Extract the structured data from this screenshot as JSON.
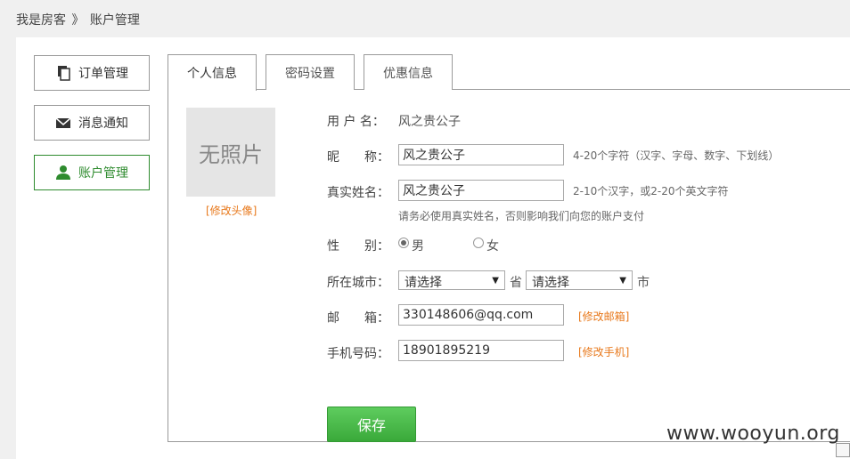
{
  "breadcrumb": {
    "home": "我是房客",
    "separator": "》",
    "current": "账户管理"
  },
  "sidebar": {
    "items": [
      {
        "label": "订单管理",
        "icon": "document-icon"
      },
      {
        "label": "消息通知",
        "icon": "envelope-icon"
      },
      {
        "label": "账户管理",
        "icon": "user-icon",
        "active": true
      }
    ]
  },
  "tabs": [
    {
      "label": "个人信息",
      "active": true
    },
    {
      "label": "密码设置"
    },
    {
      "label": "优惠信息"
    }
  ],
  "avatar": {
    "placeholder": "无照片",
    "edit_link": "[修改头像]"
  },
  "form": {
    "username": {
      "label": "用 户 名：",
      "value": "风之贵公子"
    },
    "nickname": {
      "label": "昵　　称：",
      "value": "风之贵公子",
      "hint": "4-20个字符（汉字、字母、数字、下划线）"
    },
    "realname": {
      "label": "真实姓名：",
      "value": "风之贵公子",
      "hint": "2-10个汉字，或2-20个英文字符",
      "note": "请务必使用真实姓名，否则影响我们向您的账户支付"
    },
    "gender": {
      "label": "性　　别：",
      "male": "男",
      "female": "女"
    },
    "city": {
      "label": "所在城市：",
      "province_value": "请选择",
      "province_suffix": "省",
      "city_value": "请选择",
      "city_suffix": "市"
    },
    "email": {
      "label": "邮　　箱：",
      "value": "330148606@qq.com",
      "edit_link": "[修改邮箱]"
    },
    "phone": {
      "label": "手机号码：",
      "value": "18901895219",
      "edit_link": "[修改手机]"
    }
  },
  "save_label": "保存",
  "watermark": "www.wooyun.org"
}
